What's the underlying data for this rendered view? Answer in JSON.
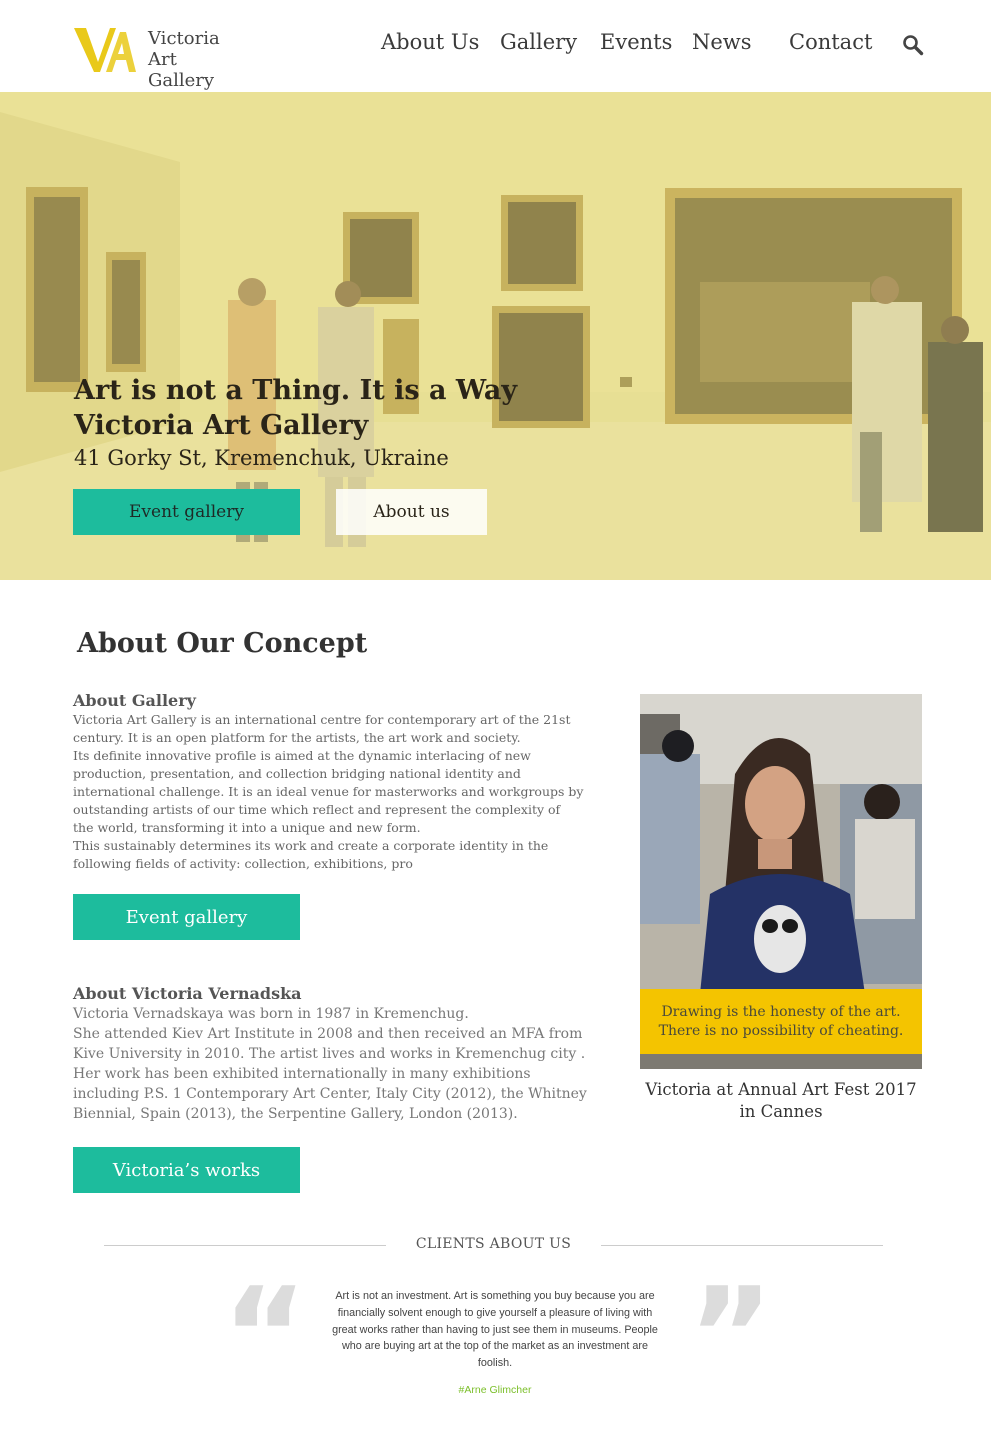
{
  "brand": {
    "logo_line1": "Victoria",
    "logo_line2": "Art Gallery",
    "logo_mark": "VA",
    "accent_color": "#e9c91a"
  },
  "nav": {
    "items": [
      {
        "label": "About Us"
      },
      {
        "label": "Gallery"
      },
      {
        "label": "Events"
      },
      {
        "label": "News"
      },
      {
        "label": "Contact"
      }
    ],
    "search_icon": "search-icon"
  },
  "hero": {
    "tagline": "Art is not a Thing. It is a Way",
    "title": "Victoria Art Gallery",
    "address": "41 Gorky St, Kremenchuk, Ukraine",
    "btn_events": "Event gallery",
    "btn_about": "About us"
  },
  "concept": {
    "title": "About Our Concept",
    "gallery": {
      "heading": "About Gallery",
      "lines": [
        "Victoria Art Gallery is an international centre for contemporary art of the 21st",
        "century. It is an open platform for the artists, the art work and society.",
        "Its definite innovative profile is aimed at the dynamic interlacing of new",
        "production, presentation, and collection bridging national identity and",
        "international challenge. It is an ideal venue for masterworks and workgroups by",
        "outstanding artists of our time which reflect and represent the complexity of",
        "the world, transforming it into a unique and new form.",
        "This sustainably determines its work and create a corporate identity in the",
        "following fields of activity: collection, exhibitions, pro"
      ],
      "button": "Event gallery"
    },
    "victoria": {
      "heading": "About Victoria Vernadska",
      "lines": [
        "Victoria Vernadskaya was born in 1987 in Kremenchug.",
        "She attended Kiev Art Institute in 2008 and then received an MFA from",
        "Kive University in 2010. The artist lives and works in Kremenchug city .",
        "Her work has been exhibited internationally in many exhibitions",
        "including P.S. 1 Contemporary Art Center, Italy City (2012), the Whitney",
        "Biennial, Spain (2013), the Serpentine Gallery, London (2013)."
      ],
      "button": "Victoria’s works"
    },
    "photo": {
      "quote_line1": "Drawing is the honesty of the art.",
      "quote_line2": "There is no possibility of cheating.",
      "caption_line1": "Victoria at Annual Art Fest 2017",
      "caption_line2": "in Cannes"
    }
  },
  "clients": {
    "title": "CLIENTS ABOUT US",
    "quote_lines": [
      "Art is not an investment. Art is something you buy because you are",
      "financially solvent enough to give yourself a pleasure of living with",
      "great works rather than having to just see them in museums. People",
      "who are buying art at the top of the market as an investment are",
      "foolish."
    ],
    "author": "#Arne Glimcher",
    "author_color": "#7bbf2a"
  },
  "colors": {
    "teal": "#1dbc9d",
    "quote_yellow": "#f4c400"
  }
}
